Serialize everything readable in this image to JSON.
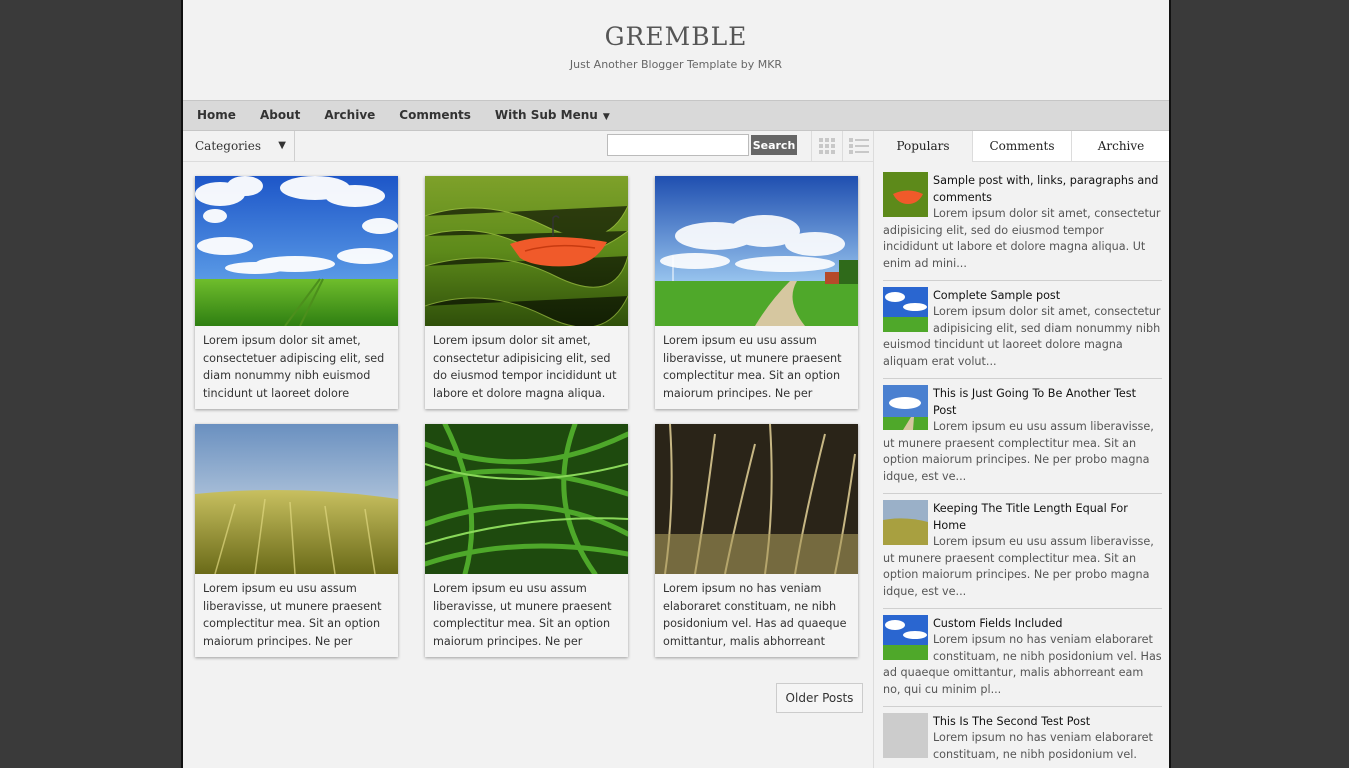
{
  "site": {
    "title": "GREMBLE",
    "description": "Just Another Blogger Template by MKR"
  },
  "nav": {
    "items": [
      {
        "label": "Home"
      },
      {
        "label": "About"
      },
      {
        "label": "Archive"
      },
      {
        "label": "Comments"
      },
      {
        "label": "With Sub Menu",
        "caret": "▼"
      }
    ]
  },
  "toolbar": {
    "categories_label": "Categories",
    "categories_arrow": "▼",
    "search_placeholder": "",
    "search_button": "Search",
    "grid_icon": "grid-view-icon",
    "list_icon": "list-view-icon"
  },
  "posts": [
    {
      "image": "sky-field",
      "excerpt": "Lorem ipsum dolor sit amet, consectetuer adipiscing elit, sed diam nonummy nibh euismod tincidunt ut laoreet dolore"
    },
    {
      "image": "umbrella-grass",
      "excerpt": "Lorem ipsum dolor sit amet, consectetur adipisicing elit, sed do eiusmod tempor incididunt ut labore et dolore magna aliqua."
    },
    {
      "image": "country-road",
      "excerpt": "Lorem ipsum eu usu assum liberavisse, ut munere praesent complectitur mea. Sit an option maiorum principes. Ne per"
    },
    {
      "image": "wheat-field",
      "excerpt": "Lorem ipsum eu usu assum liberavisse, ut munere praesent complectitur mea. Sit an option maiorum principes. Ne per"
    },
    {
      "image": "dewy-grass",
      "excerpt": "Lorem ipsum eu usu assum liberavisse, ut munere praesent complectitur mea. Sit an option maiorum principes. Ne per"
    },
    {
      "image": "dry-grass",
      "excerpt": "Lorem ipsum no has veniam elaboraret constituam, ne nibh posidonium vel. Has ad quaeque omittantur, malis abhorreant"
    }
  ],
  "pagination": {
    "older_label": "Older Posts"
  },
  "sidebar": {
    "tabs": [
      {
        "label": "Populars",
        "active": true
      },
      {
        "label": "Comments",
        "active": false
      },
      {
        "label": "Archive",
        "active": false
      }
    ],
    "popular": [
      {
        "image": "umbrella-grass",
        "title": "Sample post with, links, paragraphs and comments",
        "excerpt": "Lorem ipsum dolor sit amet, consectetur adipisicing elit, sed do eiusmod tempor incididunt ut labore et dolore magna aliqua. Ut enim ad mini..."
      },
      {
        "image": "sky-field",
        "title": "Complete Sample post",
        "excerpt": "Lorem ipsum dolor sit amet, consectetur adipisicing elit, sed diam nonummy nibh euismod tincidunt ut laoreet dolore magna aliquam erat volut..."
      },
      {
        "image": "country-road",
        "title": "This is Just Going To Be Another Test Post",
        "excerpt": "Lorem ipsum eu usu assum liberavisse, ut munere praesent complectitur mea. Sit an option maiorum principes. Ne per probo magna idque, est ve..."
      },
      {
        "image": "wheat-field",
        "title": "Keeping The Title Length Equal For Home",
        "excerpt": "Lorem ipsum eu usu assum liberavisse, ut munere praesent complectitur mea. Sit an option maiorum principes. Ne per probo magna idque, est ve..."
      },
      {
        "image": "sky-field",
        "title": "Custom Fields Included",
        "excerpt": "Lorem ipsum no has veniam elaboraret constituam, ne nibh posidonium vel. Has ad quaeque omittantur, malis abhorreant eam no, qui cu minim pl..."
      },
      {
        "image": "placeholder",
        "title": "This Is The Second Test Post",
        "excerpt": "Lorem ipsum no has veniam elaboraret constituam, ne nibh posidonium vel."
      }
    ]
  }
}
